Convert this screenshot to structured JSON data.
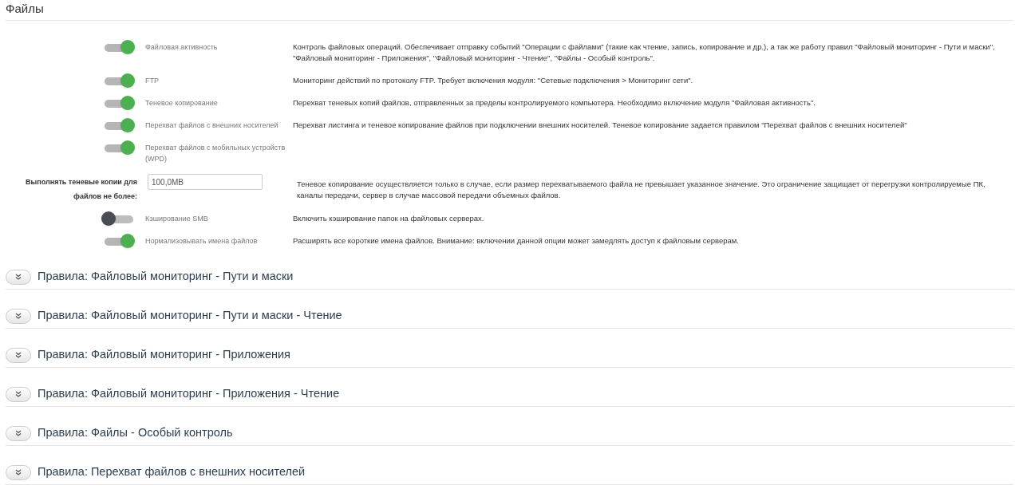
{
  "title": "Файлы",
  "settings": [
    {
      "kind": "toggle",
      "label": "Файловая активность",
      "on": true,
      "description": "Контроль файловых операций. Обеспечивает отправку событий \"Операции с файлами\" (такие как чтение, запись, копирование и др.), а так же работу правил \"Файловый мониторинг - Пути и маски\", \"Файловый мониторинг - Приложения\", \"Файловый мониторинг - Чтение\", \"Файлы - Особый контроль\"."
    },
    {
      "kind": "toggle",
      "label": "FTP",
      "on": true,
      "description": "Мониторинг действий по протоколу FTP. Требует включения модуля: \"Сетевые подключения > Мониторинг сети\"."
    },
    {
      "kind": "toggle",
      "label": "Теневое копирование",
      "on": true,
      "description": "Перехват теневых копий файлов, отправленных за пределы контролируемого компьютера. Необходимо включение модуля \"Файловая активность\"."
    },
    {
      "kind": "toggle",
      "label": "Перехват файлов с внешних носителей",
      "on": true,
      "description": "Перехват листинга и теневое копирование файлов при подключении внешних носителей. Теневое копирование задается правилом \"Перехват файлов с внешних носителей\""
    },
    {
      "kind": "toggle",
      "label": "Перехват файлов с мобильных устройств (WPD)",
      "on": true
    },
    {
      "kind": "input",
      "label": "Выполнять теневые копии для файлов не более:",
      "value": "100,0MB",
      "description": "Теневое копирование осуществляется только в случае, если размер перехватываемого файла не превышает указанное значение. Это ограничение защищает от перегрузки контролируемые ПК, каналы передачи, сервер в случае массовой передачи объемных файлов."
    },
    {
      "kind": "toggle",
      "label": "Кэширование SMB",
      "on": false,
      "description": "Включить кэширование папок на файловых серверах."
    },
    {
      "kind": "toggle",
      "label": "Нормализовывать имена файлов",
      "on": true,
      "description": "Расширять все короткие имена файлов. Внимание: включении данной опции может замедлять доступ к файловым серверам."
    }
  ],
  "sections": [
    {
      "title": "Правила: Файловый мониторинг - Пути и маски"
    },
    {
      "title": "Правила: Файловый мониторинг - Пути и маски - Чтение"
    },
    {
      "title": "Правила: Файловый мониторинг - Приложения"
    },
    {
      "title": "Правила: Файловый мониторинг - Приложения - Чтение"
    },
    {
      "title": "Правила: Файлы - Особый контроль"
    },
    {
      "title": "Правила: Перехват файлов с внешних носителей"
    }
  ]
}
